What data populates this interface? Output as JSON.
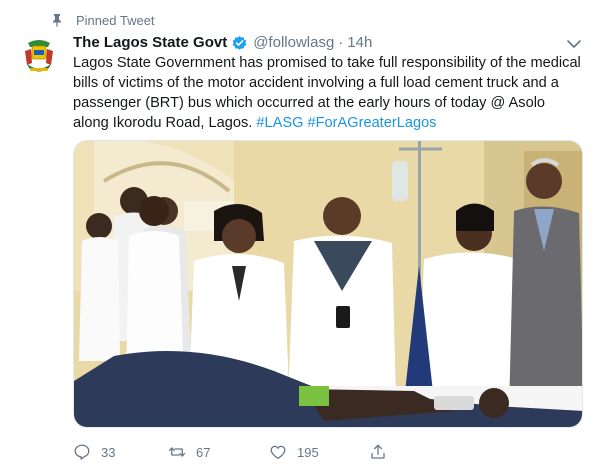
{
  "pinned": {
    "label": "Pinned Tweet",
    "icon": "pin-icon"
  },
  "author": {
    "name": "The Lagos State Govt",
    "handle": "@followlasg",
    "separator": "·",
    "time": "14h",
    "verified_icon": "verified-badge-icon",
    "avatar_icon": "lagos-state-crest-icon"
  },
  "tweet": {
    "text": "Lagos State Government has promised to take full responsibility of the medical bills of victims of the motor accident involving a full load cement truck and a passenger (BRT) bus which occurred at the early hours of today @ Asolo along Ikorodu Road, Lagos.",
    "hashtags": [
      "#LASG",
      "#ForAGreaterLagos"
    ]
  },
  "actions": {
    "reply": {
      "icon": "reply-icon",
      "count": "33"
    },
    "retweet": {
      "icon": "retweet-icon",
      "count": "67"
    },
    "like": {
      "icon": "heart-icon",
      "count": "195"
    },
    "share": {
      "icon": "share-icon"
    }
  },
  "colors": {
    "accent": "#1da1f2",
    "hashtag": "#1b95e0",
    "muted": "#657786",
    "text": "#14171a"
  }
}
